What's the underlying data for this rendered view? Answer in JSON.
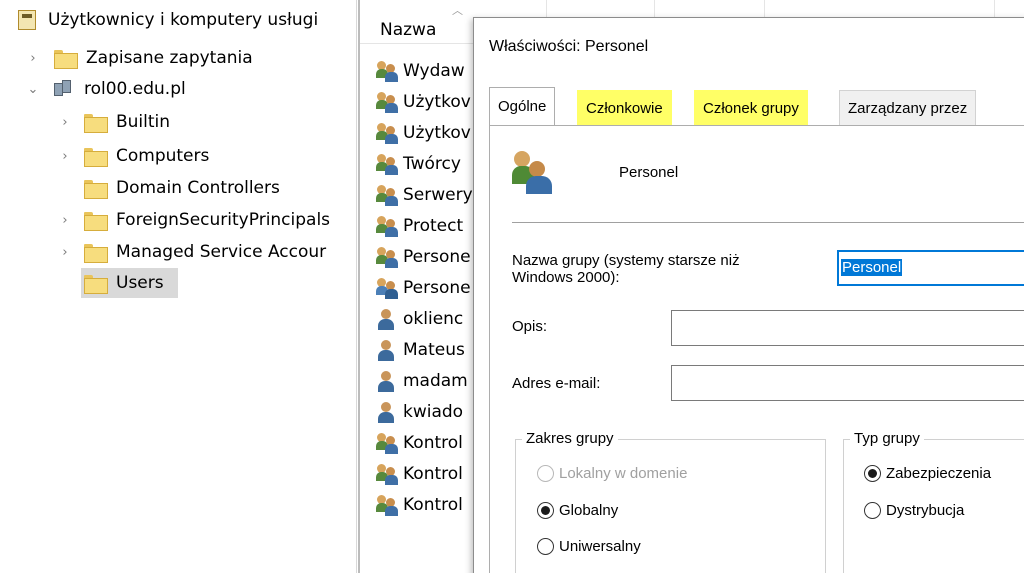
{
  "tree": {
    "root_label": "Użytkownicy i komputery usługi",
    "items": [
      {
        "label": "Zapisane zapytania",
        "expander": "›"
      },
      {
        "label": "rol00.edu.pl",
        "expander": "⌄"
      },
      {
        "label": "Builtin",
        "expander": "›"
      },
      {
        "label": "Computers",
        "expander": "›"
      },
      {
        "label": "Domain Controllers",
        "expander": ""
      },
      {
        "label": "ForeignSecurityPrincipals",
        "expander": "›"
      },
      {
        "label": "Managed Service Accour",
        "expander": "›"
      },
      {
        "label": "Users",
        "expander": ""
      }
    ],
    "selected_label": "Users"
  },
  "list": {
    "column_name": "Nazwa",
    "items": [
      {
        "label": "Wydaw",
        "icon": "group-icon"
      },
      {
        "label": "Użytkov",
        "icon": "group-icon"
      },
      {
        "label": "Użytkov",
        "icon": "group-icon"
      },
      {
        "label": "Twórcy",
        "icon": "group-icon"
      },
      {
        "label": "Serwery",
        "icon": "group-icon"
      },
      {
        "label": "Protect",
        "icon": "group-icon"
      },
      {
        "label": "Persone",
        "icon": "group-icon"
      },
      {
        "label": "Persone",
        "icon": "group-icon-selected"
      },
      {
        "label": "oklienc",
        "icon": "user-icon"
      },
      {
        "label": "Mateus",
        "icon": "user-icon"
      },
      {
        "label": "madam",
        "icon": "user-icon"
      },
      {
        "label": "kwiado",
        "icon": "user-icon"
      },
      {
        "label": "Kontrol",
        "icon": "group-icon"
      },
      {
        "label": "Kontrol",
        "icon": "group-icon"
      },
      {
        "label": "Kontrol",
        "icon": "group-icon"
      }
    ]
  },
  "dialog": {
    "title": "Właściwości: Personel",
    "tabs": [
      {
        "label": "Ogólne",
        "active": true,
        "highlighted": false
      },
      {
        "label": "Członkowie",
        "active": false,
        "highlighted": true
      },
      {
        "label": "Członek grupy",
        "active": false,
        "highlighted": true
      },
      {
        "label": "Zarządzany przez",
        "active": false,
        "highlighted": false
      }
    ],
    "highlight_color": "#ffff66",
    "group_name": "Personel",
    "legacy_name_label_line1": "Nazwa grupy (systemy starsze niż",
    "legacy_name_label_line2": "Windows 2000):",
    "legacy_name_value": "Personel",
    "description_label": "Opis:",
    "description_value": "",
    "email_label": "Adres e-mail:",
    "email_value": "",
    "scope": {
      "legend": "Zakres grupy",
      "options": [
        {
          "label": "Lokalny w domenie",
          "checked": false,
          "disabled": true
        },
        {
          "label": "Globalny",
          "checked": true,
          "disabled": false
        },
        {
          "label": "Uniwersalny",
          "checked": false,
          "disabled": false
        }
      ]
    },
    "type": {
      "legend": "Typ grupy",
      "options": [
        {
          "label": "Zabezpieczenia",
          "checked": true,
          "disabled": false
        },
        {
          "label": "Dystrybucja",
          "checked": false,
          "disabled": false
        }
      ]
    }
  }
}
